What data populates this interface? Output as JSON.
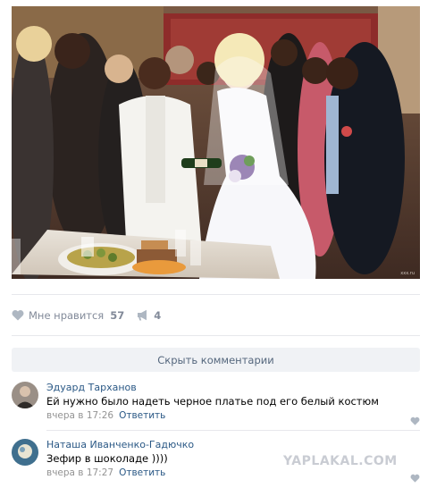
{
  "post": {
    "photo_description": "wedding-photo",
    "photo_source": "xxx.ru"
  },
  "actions": {
    "like_label": "Мне нравится",
    "like_count": "57",
    "share_count": "4"
  },
  "comments_toggle": {
    "label": "Скрыть комментарии"
  },
  "comments": [
    {
      "author": "Эдуард Тарханов",
      "text": "Ей нужно было надеть черное платье под его белый костюм",
      "time": "вчера в 17:26",
      "reply_label": "Ответить"
    },
    {
      "author": "Наташа Иванченко-Гадючко",
      "text": "Зефир в шоколаде ))))",
      "time": "вчера в 17:27",
      "reply_label": "Ответить"
    }
  ],
  "watermark": "YAPLAKAL.COM",
  "colors": {
    "link": "#2a5885",
    "muted": "#828a99",
    "toggle_bg": "#f0f2f5",
    "icon": "#aeb7c2"
  }
}
